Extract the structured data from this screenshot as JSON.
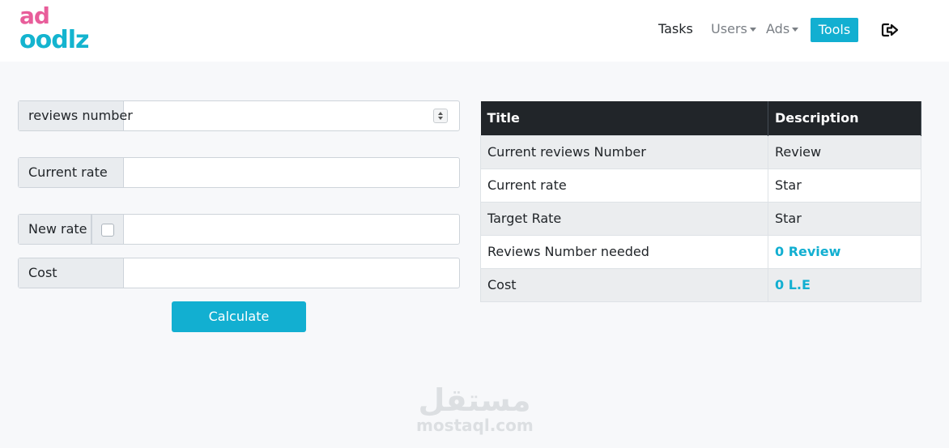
{
  "brand": {
    "line1": "ad",
    "line2": "oodlz",
    "pink": "#e85d9a",
    "cyan": "#14b4cf"
  },
  "nav": {
    "tasks": "Tasks",
    "users": "Users",
    "ads": "Ads",
    "tools": "Tools",
    "logout_icon": "logout-icon"
  },
  "form": {
    "reviews_label": "reviews number",
    "reviews_value": "",
    "current_rate_label": "Current rate",
    "current_rate_value": "",
    "new_rate_label": "New rate",
    "new_rate_checked": false,
    "new_rate_value": "",
    "cost_label": "Cost",
    "cost_value": "",
    "calculate": "Calculate"
  },
  "table": {
    "headers": [
      "Title",
      "Description"
    ],
    "rows": [
      {
        "title": "Current reviews Number",
        "desc": "Review"
      },
      {
        "title": "Current rate",
        "desc": "Star"
      },
      {
        "title": "Target Rate",
        "desc": "Star"
      },
      {
        "title": "Reviews Number needed",
        "desc": "0 Review"
      },
      {
        "title": "Cost",
        "desc": "0 L.E"
      }
    ]
  },
  "watermark": {
    "arabic": "مستقل",
    "latin": "mostaql.com"
  },
  "colors": {
    "accent": "#12afd1",
    "table_header": "#212529",
    "background": "#f7f8fa"
  }
}
